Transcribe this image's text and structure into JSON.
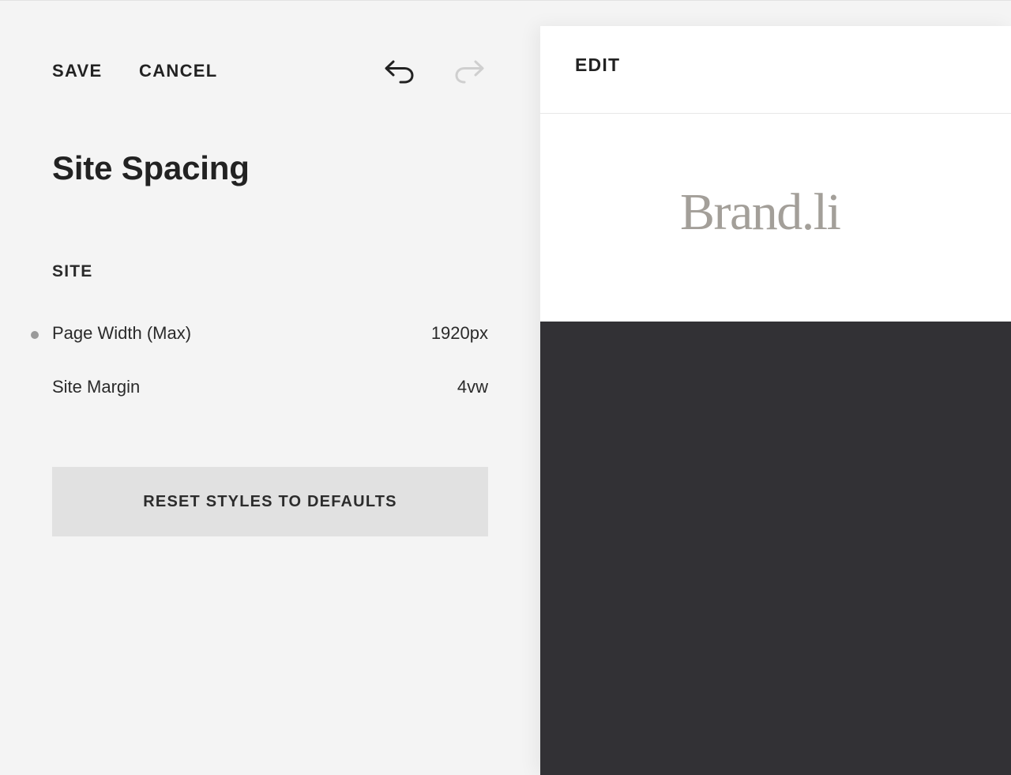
{
  "toolbar": {
    "save_label": "SAVE",
    "cancel_label": "CANCEL",
    "undo_icon": "undo-icon",
    "redo_icon": "redo-icon"
  },
  "panel": {
    "title": "Site Spacing",
    "section_label": "SITE",
    "rows": [
      {
        "label": "Page Width (Max)",
        "value": "1920px",
        "modified": true
      },
      {
        "label": "Site Margin",
        "value": "4vw",
        "modified": false
      }
    ],
    "reset_label": "RESET STYLES TO DEFAULTS"
  },
  "preview": {
    "edit_label": "EDIT",
    "logo_text": "Brand.li"
  },
  "colors": {
    "panel_bg": "#f4f4f4",
    "button_bg": "#e1e1e1",
    "logo": "#a39f99",
    "dark_section": "#323135",
    "modified_dot": "#9a9a9a"
  }
}
